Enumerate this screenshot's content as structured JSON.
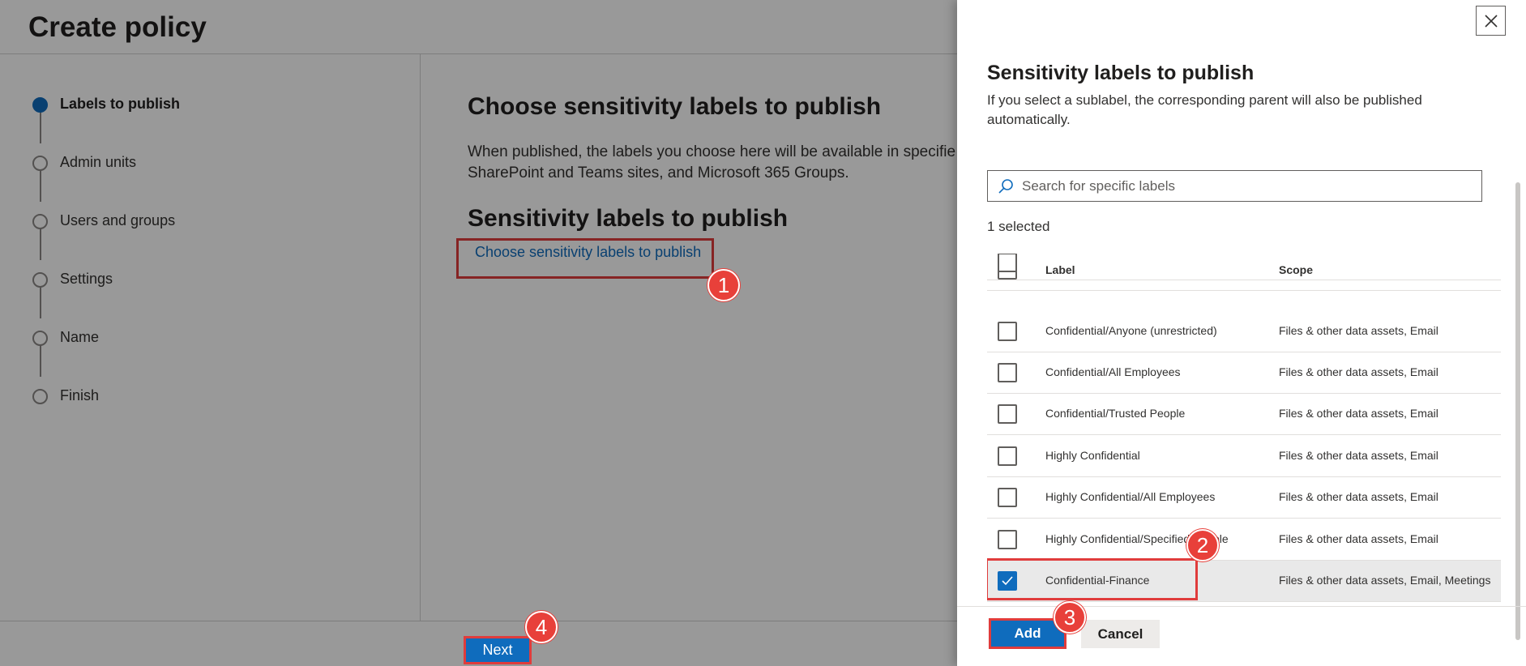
{
  "wizard": {
    "title": "Create policy",
    "steps": [
      {
        "label": "Labels to publish",
        "active": true
      },
      {
        "label": "Admin units",
        "active": false
      },
      {
        "label": "Users and groups",
        "active": false
      },
      {
        "label": "Settings",
        "active": false
      },
      {
        "label": "Name",
        "active": false
      },
      {
        "label": "Finish",
        "active": false
      }
    ],
    "main": {
      "heading": "Choose sensitivity labels to publish",
      "description": "When published, the labels you choose here will be available in specifie SharePoint and Teams sites, and Microsoft 365 Groups.",
      "subheading": "Sensitivity labels to publish",
      "choose_link": "Choose sensitivity labels to publish"
    },
    "footer": {
      "next_label": "Next"
    }
  },
  "panel": {
    "title": "Sensitivity labels to publish",
    "description": "If you select a sublabel, the corresponding parent will also be published automatically.",
    "search_placeholder": "Search for specific labels",
    "selected_count": "1 selected",
    "columns": {
      "label": "Label",
      "scope": "Scope"
    },
    "rows": [
      {
        "label": "Confidential/Anyone (unrestricted)",
        "scope": "Files & other data assets, Email",
        "checked": false
      },
      {
        "label": "Confidential/All Employees",
        "scope": "Files & other data assets, Email",
        "checked": false
      },
      {
        "label": "Confidential/Trusted People",
        "scope": "Files & other data assets, Email",
        "checked": false
      },
      {
        "label": "Highly Confidential",
        "scope": "Files & other data assets, Email",
        "checked": false
      },
      {
        "label": "Highly Confidential/All Employees",
        "scope": "Files & other data assets, Email",
        "checked": false
      },
      {
        "label": "Highly Confidential/Specified People",
        "scope": "Files & other data assets, Email",
        "checked": false
      },
      {
        "label": "Confidential-Finance",
        "scope": "Files & other data assets, Email, Meetings",
        "checked": true
      }
    ],
    "add_label": "Add",
    "cancel_label": "Cancel"
  },
  "callouts": [
    "1",
    "2",
    "3",
    "4"
  ],
  "colors": {
    "accent": "#0f6cbd",
    "callout": "#e8403a",
    "highlight_border": "#e03c3c"
  }
}
